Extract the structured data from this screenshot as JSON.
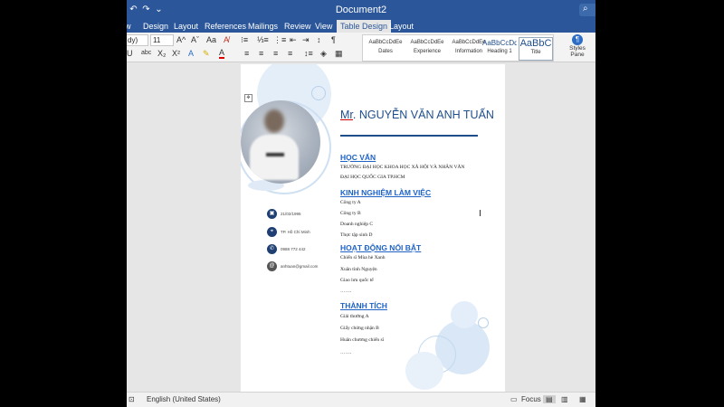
{
  "window": {
    "title": "Document2"
  },
  "tabs": [
    {
      "label": "w"
    },
    {
      "label": "Design"
    },
    {
      "label": "Layout"
    },
    {
      "label": "References"
    },
    {
      "label": "Mailings"
    },
    {
      "label": "Review"
    },
    {
      "label": "View"
    },
    {
      "label": "Table Design"
    },
    {
      "label": "Layout"
    }
  ],
  "ribbon": {
    "font_name": "dy)",
    "font_size": "11",
    "grow_font": "A^",
    "shrink_font": "Aˇ",
    "change_case": "Aa",
    "bold": "U",
    "strike": "abc",
    "subscript": "X₂",
    "superscript": "X²",
    "paragraph_mark": "¶",
    "styles": [
      {
        "sample": "AaBbCcDdEe",
        "name": "Dates"
      },
      {
        "sample": "AaBbCcDdEe",
        "name": "Experience"
      },
      {
        "sample": "AaBbCcDdEe",
        "name": "Information"
      },
      {
        "sample": "AaBbCcDd",
        "name": "Heading 1"
      },
      {
        "sample": "AaBbC",
        "name": "Title"
      }
    ],
    "styles_pane": {
      "line1": "Styles",
      "line2": "Pane"
    }
  },
  "resume": {
    "name": "Mr. NGUYỄN VĂN ANH TUẤN",
    "contacts": [
      {
        "icon": "calendar-icon",
        "text": "21/02/1995"
      },
      {
        "icon": "location-icon",
        "text": "TP. Hồ Chí Minh"
      },
      {
        "icon": "phone-icon",
        "text": "0988 772 442"
      },
      {
        "icon": "email-icon",
        "text": "anhtuan@gmail.com"
      }
    ],
    "sections": [
      {
        "title": "HỌC VẤN",
        "lines": [
          "TRƯỜNG ĐẠI HỌC KHOA HỌC XÃ HỘI VÀ NHÂN VĂN",
          "ĐẠI HỌC QUỐC GIA TP.HCM"
        ]
      },
      {
        "title": "KINH NGHIỆM LÀM VIỆC",
        "lines": [
          "Công ty A",
          "Công ty B",
          "Doanh nghiệp C",
          "Thực tập sinh D"
        ]
      },
      {
        "title": "HOẠT ĐỘNG NỔI BẬT",
        "lines": [
          "Chiến sĩ Mùa hè Xanh",
          "Xuân tình Nguyện",
          "Giao lưu quốc tế",
          "……."
        ]
      },
      {
        "title": "THÀNH TÍCH",
        "lines": [
          "Giải thưởng A",
          "Giấy chứng nhận B",
          "Huân chương chiến sĩ",
          "……."
        ]
      }
    ]
  },
  "status": {
    "language": "English (United States)",
    "focus": "Focus"
  },
  "colors": {
    "brand": "#2b579a",
    "heading": "#1f63c6",
    "name": "#1f4e8c"
  }
}
